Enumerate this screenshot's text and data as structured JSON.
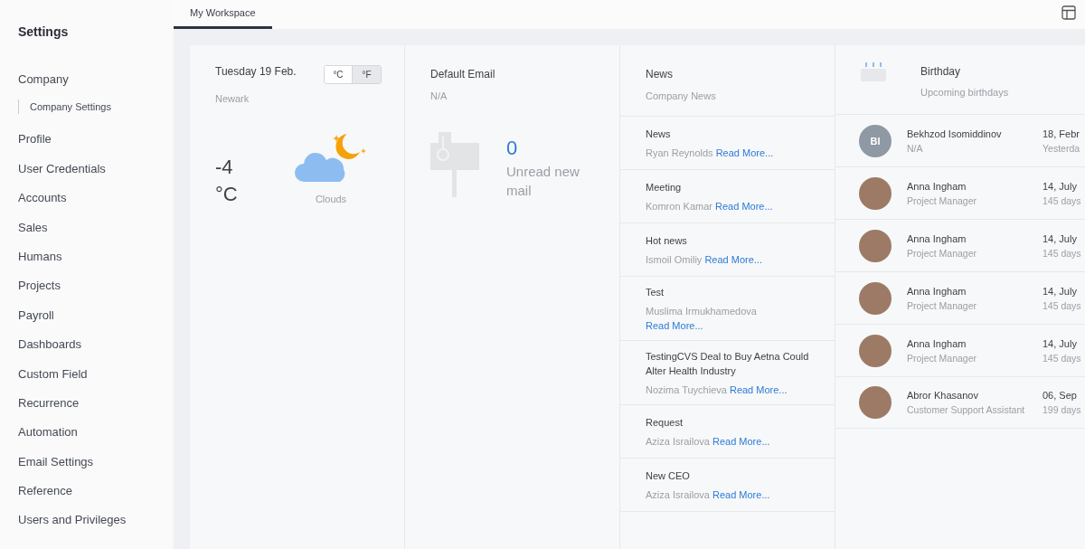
{
  "sidebar": {
    "title": "Settings",
    "items": [
      {
        "label": "Company",
        "children": [
          {
            "label": "Company Settings"
          }
        ]
      },
      {
        "label": "Profile"
      },
      {
        "label": "User Credentials"
      },
      {
        "label": "Accounts"
      },
      {
        "label": "Sales"
      },
      {
        "label": "Humans"
      },
      {
        "label": "Projects"
      },
      {
        "label": "Payroll"
      },
      {
        "label": "Dashboards"
      },
      {
        "label": "Custom Field"
      },
      {
        "label": "Recurrence"
      },
      {
        "label": "Automation"
      },
      {
        "label": "Email Settings"
      },
      {
        "label": "Reference"
      },
      {
        "label": "Users and Privileges"
      }
    ]
  },
  "tabs": [
    {
      "label": "My Workspace",
      "selected": true
    }
  ],
  "weather": {
    "date": "Tuesday 19 Feb.",
    "city": "Newark",
    "units": [
      {
        "label": "°C",
        "selected": false
      },
      {
        "label": "°F",
        "selected": true
      }
    ],
    "temperature": "-4",
    "temperature_unit": "°C",
    "condition": "Clouds"
  },
  "email": {
    "title": "Default Email",
    "subtitle": "N/A",
    "count": "0",
    "count_label": "Unread new mail"
  },
  "news": {
    "title": "News",
    "subtitle": "Company News",
    "items": [
      {
        "title": "News",
        "author": "Ryan Reynolds",
        "link": "Read More..."
      },
      {
        "title": "Meeting",
        "author": "Komron Kamar",
        "link": "Read More..."
      },
      {
        "title": "Hot news",
        "author": "Ismoil Omiliy",
        "link": "Read More..."
      },
      {
        "title": "Test",
        "author": "Muslima Irmukhamedova",
        "link": "Read More..."
      },
      {
        "title": "TestingCVS Deal to Buy Aetna Could Alter Health Industry",
        "author": "Nozima Tuychieva",
        "link": "Read More..."
      },
      {
        "title": "Request",
        "author": "Aziza Israilova",
        "link": "Read More..."
      },
      {
        "title": "New CEO",
        "author": "Aziza Israilova",
        "link": "Read More..."
      }
    ]
  },
  "birthday": {
    "title": "Birthday",
    "subtitle": "Upcoming birthdays",
    "people": [
      {
        "kind": "initials",
        "initials": "BI",
        "name": "Bekhzod Isomiddinov",
        "role": "N/A",
        "date": "18, Febr",
        "when": "Yesterda"
      },
      {
        "kind": "photo",
        "name": "Anna Ingham",
        "role": "Project Manager",
        "date": "14, July",
        "when": "145 days"
      },
      {
        "kind": "photo",
        "name": "Anna Ingham",
        "role": "Project Manager",
        "date": "14, July",
        "when": "145 days"
      },
      {
        "kind": "photo",
        "name": "Anna Ingham",
        "role": "Project Manager",
        "date": "14, July",
        "when": "145 days"
      },
      {
        "kind": "photo",
        "name": "Anna Ingham",
        "role": "Project Manager",
        "date": "14, July",
        "when": "145 days"
      },
      {
        "kind": "photo",
        "name": "Abror Khasanov",
        "role": "Customer Support Assistant",
        "date": "06, Sep",
        "when": "199 days"
      }
    ]
  }
}
